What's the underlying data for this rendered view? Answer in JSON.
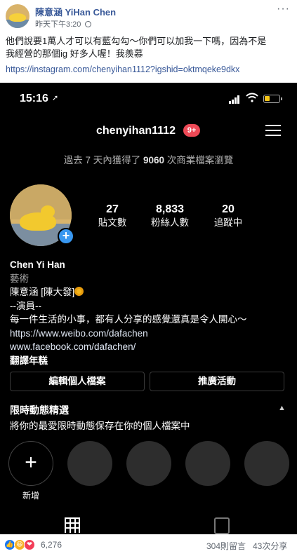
{
  "post": {
    "author": "陳意涵 YiHan Chen",
    "timestamp": "昨天下午3:20",
    "more_label": "···",
    "text_line1": "他們說要1萬人才可以有藍勾勾～你們可以加我一下嗎，因為不是",
    "text_line2": "我經營的那個ig 好多人喔！我羨慕",
    "link": "https://instagram.com/chenyihan1112?igshid=oktmqeke9dkx"
  },
  "screenshot": {
    "status_time": "15:16",
    "status_arrow": "➚",
    "username": "chenyihan1112",
    "notification_badge": "9+",
    "insights": {
      "prefix": "過去 7 天內獲得了 ",
      "count": "9060",
      "suffix": " 次商業檔案瀏覽"
    },
    "stats": [
      {
        "value": "27",
        "label": "貼文數"
      },
      {
        "value": "8,833",
        "label": "粉絲人數"
      },
      {
        "value": "20",
        "label": "追蹤中"
      }
    ],
    "bio": {
      "name": "Chen Yi Han",
      "category": "藝術",
      "line1": "陳意涵 [陳大發]",
      "line2": "--演員--",
      "line3": "每一件生活的小事，都有人分享的感覺還真是令人開心～",
      "line4": "https://www.weibo.com/dafachen",
      "line5": "www.facebook.com/dafachen/",
      "translate": "翻譯年糕"
    },
    "buttons": {
      "edit_profile": "編輯個人檔案",
      "promotions": "推廣活動"
    },
    "highlights": {
      "title": "限時動態精選",
      "subtitle": "將你的最愛限時動態保存在你的個人檔案中",
      "new_label": "新增"
    }
  },
  "reactions": {
    "count": "6,276",
    "comments": "304則留言",
    "shares": "43次分享",
    "colors": {
      "like": "#1877f2",
      "haha": "#f7b125",
      "love": "#f33e58"
    }
  }
}
